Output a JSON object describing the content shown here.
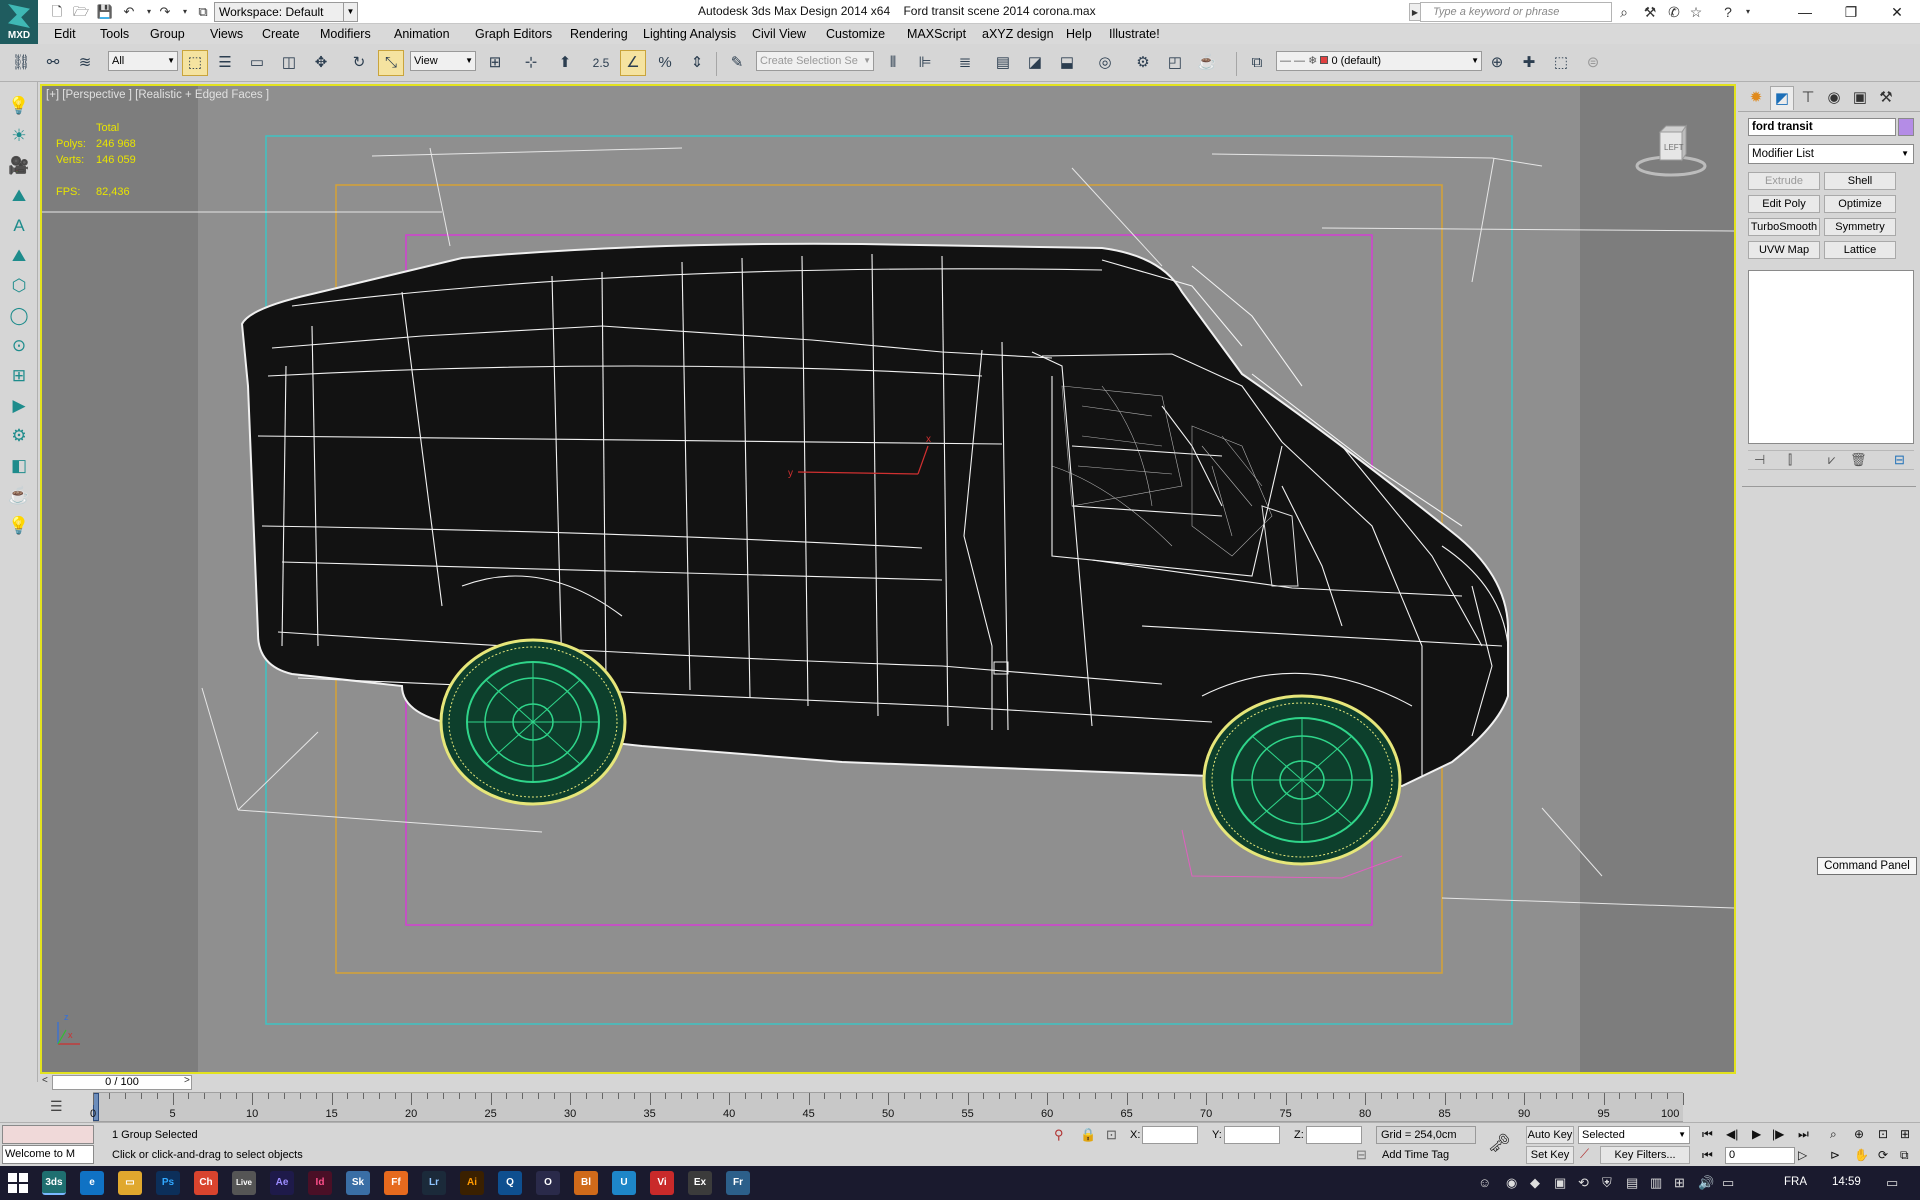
{
  "title_bar": {
    "app_title": "Autodesk 3ds Max Design 2014 x64",
    "file_title": "Ford transit scene 2014 corona.max",
    "workspace": "Workspace: Default",
    "search_placeholder": "Type a keyword or phrase",
    "app_logo": "MXD"
  },
  "menu": [
    "Edit",
    "Tools",
    "Group",
    "Views",
    "Create",
    "Modifiers",
    "Animation",
    "Graph Editors",
    "Rendering",
    "Lighting Analysis",
    "Civil View",
    "Customize",
    "MAXScript",
    "aXYZ design",
    "Help",
    "Illustrate!"
  ],
  "toolbar": {
    "filter": "All",
    "ref_coord": "View",
    "snap_value": "2.5",
    "selection_set_placeholder": "Create Selection Se",
    "layer": "0 (default)"
  },
  "viewport": {
    "label": "[+] [Perspective ] [Realistic + Edged Faces ]",
    "stats": {
      "header": "Total",
      "polys_label": "Polys:",
      "polys": "246 968",
      "verts_label": "Verts:",
      "verts": "146 059",
      "fps_label": "FPS:",
      "fps": "82,436"
    },
    "gizmo_x": "x",
    "gizmo_y": "y",
    "axis_z": "z",
    "axis_x": "x",
    "viewcube": "LEFT"
  },
  "command_panel": {
    "object_name": "ford transit",
    "modifier_list": "Modifier List",
    "buttons": [
      "Extrude",
      "Shell",
      "Edit Poly",
      "Optimize",
      "TurboSmooth",
      "Symmetry",
      "UVW Map",
      "Lattice"
    ],
    "tooltip": "Command Panel"
  },
  "time_slider": {
    "frame": "0 / 100",
    "ticks": [
      "0",
      "5",
      "10",
      "15",
      "20",
      "25",
      "30",
      "35",
      "40",
      "45",
      "50",
      "55",
      "60",
      "65",
      "70",
      "75",
      "80",
      "85",
      "90",
      "95",
      "100"
    ]
  },
  "status_bar": {
    "selection": "1 Group Selected",
    "prompt": "Click or click-and-drag to select objects",
    "maxscript": "Welcome to M",
    "x_label": "X:",
    "y_label": "Y:",
    "z_label": "Z:",
    "grid": "Grid = 254,0cm",
    "auto_key": "Auto Key",
    "set_key": "Set Key",
    "selected": "Selected",
    "key_filters": "Key Filters...",
    "add_time_tag": "Add Time Tag",
    "current_frame": "0"
  },
  "taskbar": {
    "apps": [
      "3ds",
      "e",
      "Ps",
      "Ch",
      "Live",
      "Ae",
      "Id",
      "Sk",
      "Ff",
      "Lr",
      "Ai",
      "Q",
      "O",
      "Bl",
      "U",
      "Vi",
      "Ex",
      "Fr"
    ],
    "lang": "FRA",
    "time": "14:59"
  },
  "colors": {
    "viewport_bg": "#8f8f8f",
    "active_border": "#e2e21e",
    "stats_text": "#e8e400",
    "safe_frame_outer": "#3ec3c3",
    "safe_frame_mid": "#d6a235",
    "safe_frame_inner": "#d43fd4",
    "wheel_green": "#2fd58a",
    "wheel_yellow": "#e6e67a"
  }
}
